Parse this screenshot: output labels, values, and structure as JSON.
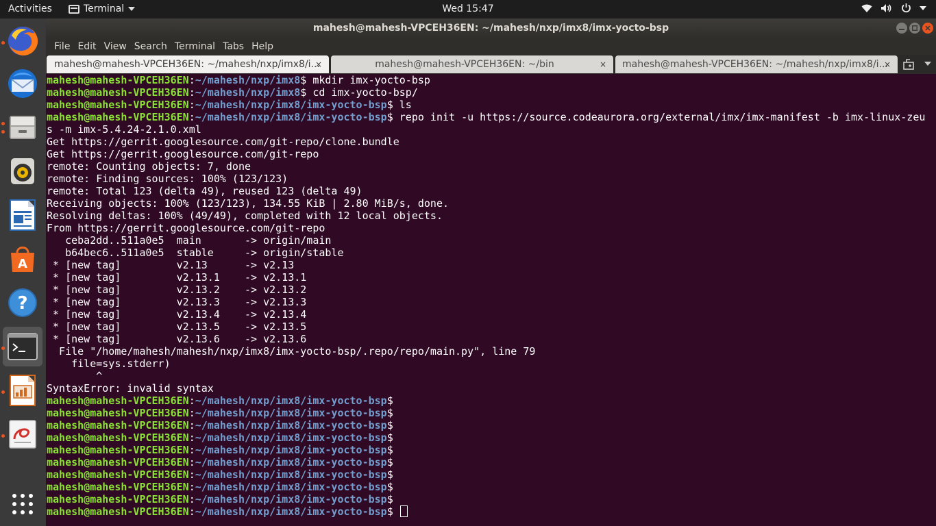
{
  "topbar": {
    "activities": "Activities",
    "app_name": "Terminal",
    "clock": "Wed 15:47"
  },
  "dock": {
    "items": [
      {
        "name": "firefox",
        "icon": "firefox-icon"
      },
      {
        "name": "thunderbird",
        "icon": "thunderbird-icon"
      },
      {
        "name": "files",
        "icon": "files-icon"
      },
      {
        "name": "rhythmbox",
        "icon": "rhythmbox-icon"
      },
      {
        "name": "writer",
        "icon": "libreoffice-writer-icon"
      },
      {
        "name": "software",
        "icon": "ubuntu-software-icon"
      },
      {
        "name": "help",
        "icon": "help-icon"
      },
      {
        "name": "terminal",
        "icon": "terminal-icon"
      },
      {
        "name": "impress",
        "icon": "libreoffice-impress-icon"
      },
      {
        "name": "evince",
        "icon": "document-viewer-icon"
      },
      {
        "name": "show-apps",
        "icon": "show-applications-icon"
      }
    ]
  },
  "window": {
    "title": "mahesh@mahesh-VPCEH36EN: ~/mahesh/nxp/imx8/imx-yocto-bsp",
    "menu": [
      "File",
      "Edit",
      "View",
      "Search",
      "Terminal",
      "Tabs",
      "Help"
    ],
    "tabs": [
      {
        "label": "mahesh@mahesh-VPCEH36EN: ~/mahesh/nxp/imx8/i...",
        "close": "×"
      },
      {
        "label": "mahesh@mahesh-VPCEH36EN: ~/bin",
        "close": "×"
      },
      {
        "label": "mahesh@mahesh-VPCEH36EN: ~/mahesh/nxp/imx8/i...",
        "close": "×"
      }
    ]
  },
  "terminal": {
    "user": "mahesh@mahesh-VPCEH36EN",
    "lines": [
      {
        "type": "prompt",
        "path": "~/mahesh/nxp/imx8",
        "cmd": " mkdir imx-yocto-bsp"
      },
      {
        "type": "prompt",
        "path": "~/mahesh/nxp/imx8",
        "cmd": " cd imx-yocto-bsp/"
      },
      {
        "type": "prompt",
        "path": "~/mahesh/nxp/imx8/imx-yocto-bsp",
        "cmd": " ls"
      },
      {
        "type": "prompt",
        "path": "~/mahesh/nxp/imx8/imx-yocto-bsp",
        "cmd": " repo init -u https://source.codeaurora.org/external/imx/imx-manifest -b imx-linux-zeu"
      },
      {
        "type": "out",
        "text": "s -m imx-5.4.24-2.1.0.xml"
      },
      {
        "type": "out",
        "text": "Get https://gerrit.googlesource.com/git-repo/clone.bundle"
      },
      {
        "type": "out",
        "text": "Get https://gerrit.googlesource.com/git-repo"
      },
      {
        "type": "out",
        "text": "remote: Counting objects: 7, done"
      },
      {
        "type": "out",
        "text": "remote: Finding sources: 100% (123/123)"
      },
      {
        "type": "out",
        "text": "remote: Total 123 (delta 49), reused 123 (delta 49)"
      },
      {
        "type": "out",
        "text": "Receiving objects: 100% (123/123), 134.55 KiB | 2.80 MiB/s, done."
      },
      {
        "type": "out",
        "text": "Resolving deltas: 100% (49/49), completed with 12 local objects."
      },
      {
        "type": "out",
        "text": "From https://gerrit.googlesource.com/git-repo"
      },
      {
        "type": "out",
        "text": "   ceba2dd..511a0e5  main       -> origin/main"
      },
      {
        "type": "out",
        "text": "   b64bec6..511a0e5  stable     -> origin/stable"
      },
      {
        "type": "out",
        "text": " * [new tag]         v2.13      -> v2.13"
      },
      {
        "type": "out",
        "text": " * [new tag]         v2.13.1    -> v2.13.1"
      },
      {
        "type": "out",
        "text": " * [new tag]         v2.13.2    -> v2.13.2"
      },
      {
        "type": "out",
        "text": " * [new tag]         v2.13.3    -> v2.13.3"
      },
      {
        "type": "out",
        "text": " * [new tag]         v2.13.4    -> v2.13.4"
      },
      {
        "type": "out",
        "text": " * [new tag]         v2.13.5    -> v2.13.5"
      },
      {
        "type": "out",
        "text": " * [new tag]         v2.13.6    -> v2.13.6"
      },
      {
        "type": "out",
        "text": "  File \"/home/mahesh/mahesh/nxp/imx8/imx-yocto-bsp/.repo/repo/main.py\", line 79"
      },
      {
        "type": "out",
        "text": "    file=sys.stderr)"
      },
      {
        "type": "out",
        "text": "        ^"
      },
      {
        "type": "out",
        "text": "SyntaxError: invalid syntax"
      },
      {
        "type": "prompt",
        "path": "~/mahesh/nxp/imx8/imx-yocto-bsp",
        "cmd": ""
      },
      {
        "type": "prompt",
        "path": "~/mahesh/nxp/imx8/imx-yocto-bsp",
        "cmd": ""
      },
      {
        "type": "prompt",
        "path": "~/mahesh/nxp/imx8/imx-yocto-bsp",
        "cmd": ""
      },
      {
        "type": "prompt",
        "path": "~/mahesh/nxp/imx8/imx-yocto-bsp",
        "cmd": ""
      },
      {
        "type": "prompt",
        "path": "~/mahesh/nxp/imx8/imx-yocto-bsp",
        "cmd": ""
      },
      {
        "type": "prompt",
        "path": "~/mahesh/nxp/imx8/imx-yocto-bsp",
        "cmd": ""
      },
      {
        "type": "prompt",
        "path": "~/mahesh/nxp/imx8/imx-yocto-bsp",
        "cmd": ""
      },
      {
        "type": "prompt",
        "path": "~/mahesh/nxp/imx8/imx-yocto-bsp",
        "cmd": ""
      },
      {
        "type": "prompt",
        "path": "~/mahesh/nxp/imx8/imx-yocto-bsp",
        "cmd": ""
      },
      {
        "type": "prompt",
        "path": "~/mahesh/nxp/imx8/imx-yocto-bsp",
        "cmd": " ",
        "cursor": true
      }
    ]
  },
  "colors": {
    "terminal_bg": "#300a24",
    "user_green": "#8ae234",
    "path_blue": "#729fcf",
    "accent": "#e95420"
  }
}
